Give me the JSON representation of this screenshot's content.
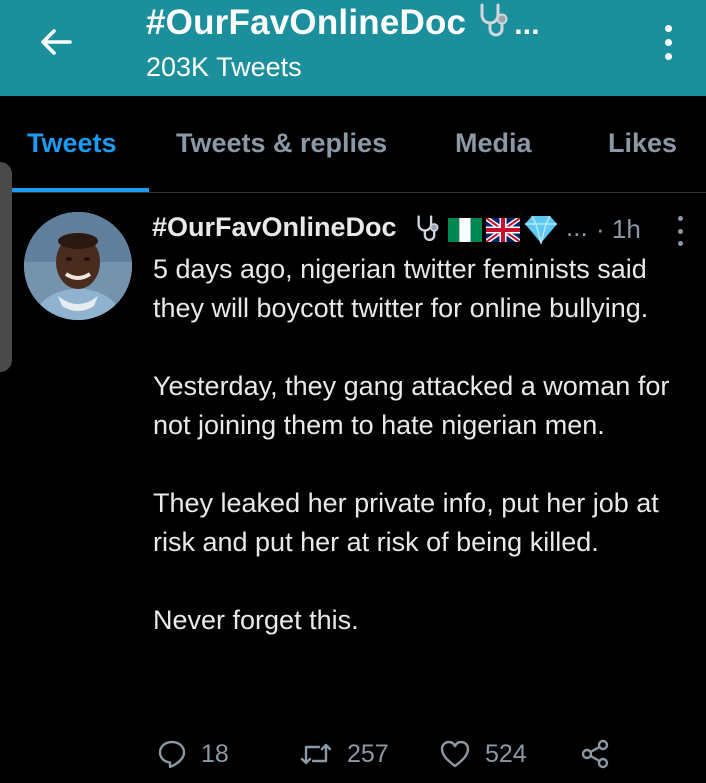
{
  "header": {
    "title": "#OurFavOnlineDoc",
    "title_icon": "stethoscope-icon",
    "title_ellipsis": "...",
    "subtitle": "203K Tweets",
    "back_icon": "back-arrow-icon",
    "more_icon": "more-vertical-icon",
    "background_color": "#1b8f9b"
  },
  "tabs": [
    {
      "label": "Tweets",
      "active": true
    },
    {
      "label": "Tweets & replies",
      "active": false
    },
    {
      "label": "Media",
      "active": false
    },
    {
      "label": "Likes",
      "active": false
    }
  ],
  "accent_color": "#1d9bf0",
  "tweet": {
    "author": "#OurFavOnlineDoc",
    "author_emojis": [
      "stethoscope-icon",
      "nigeria-flag-icon",
      "uk-flag-icon",
      "gem-icon"
    ],
    "meta_ellipsis": "...",
    "time": "· 1h",
    "paragraphs": [
      "5 days ago, nigerian twitter feminists said they will boycott twitter for online bullying.",
      "Yesterday, they gang attacked a woman for not joining them to hate nigerian men.",
      "They leaked her private info, put her job at risk and put her at risk of being killed.",
      "Never forget this."
    ],
    "actions": {
      "replies": "18",
      "retweets": "257",
      "likes": "524"
    }
  }
}
